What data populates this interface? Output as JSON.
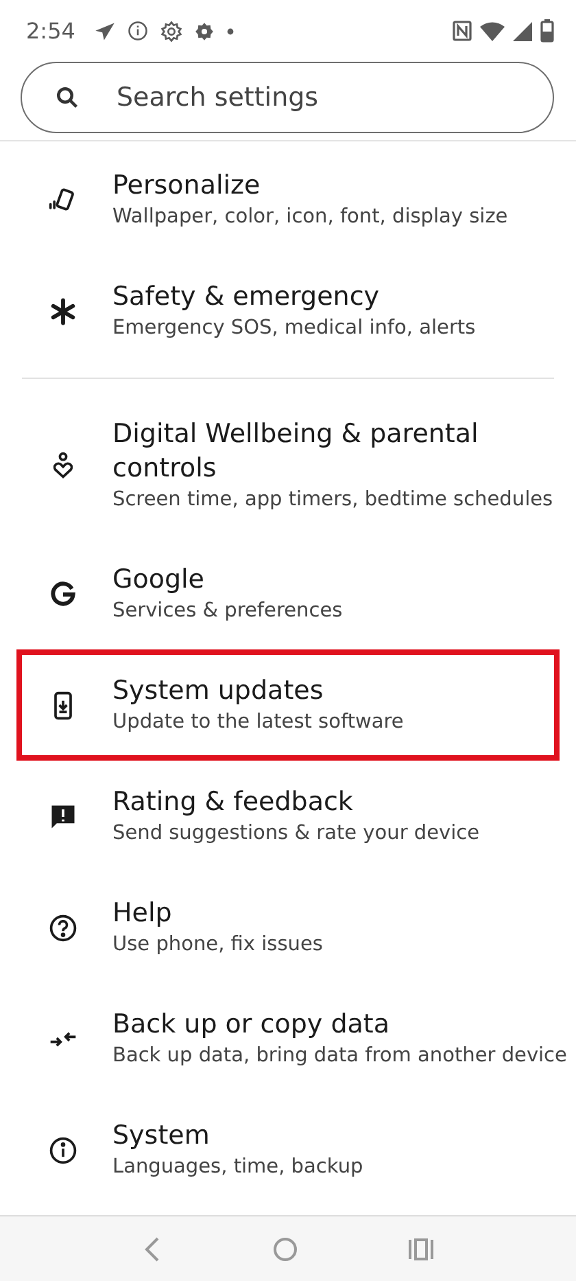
{
  "status_bar": {
    "time": "2:54"
  },
  "search": {
    "placeholder": "Search settings"
  },
  "sections": [
    {
      "items": [
        {
          "kind": "personalize",
          "title": "Personalize",
          "subtitle": "Wallpaper, color, icon, font, display size",
          "highlighted": false
        },
        {
          "kind": "safety",
          "title": "Safety & emergency",
          "subtitle": "Emergency SOS, medical info, alerts",
          "highlighted": false
        }
      ]
    },
    {
      "items": [
        {
          "kind": "wellbeing",
          "title": "Digital Wellbeing & parental controls",
          "subtitle": "Screen time, app timers, bedtime schedules",
          "highlighted": false
        },
        {
          "kind": "google",
          "title": "Google",
          "subtitle": "Services & preferences",
          "highlighted": false
        },
        {
          "kind": "update",
          "title": "System updates",
          "subtitle": "Update to the latest software",
          "highlighted": true
        },
        {
          "kind": "feedback",
          "title": "Rating & feedback",
          "subtitle": "Send suggestions & rate your device",
          "highlighted": false
        },
        {
          "kind": "help",
          "title": "Help",
          "subtitle": "Use phone, fix issues",
          "highlighted": false
        },
        {
          "kind": "backup",
          "title": "Back up or copy data",
          "subtitle": "Back up data, bring data from another device",
          "highlighted": false
        },
        {
          "kind": "system",
          "title": "System",
          "subtitle": "Languages, time, backup",
          "highlighted": false
        }
      ]
    }
  ]
}
